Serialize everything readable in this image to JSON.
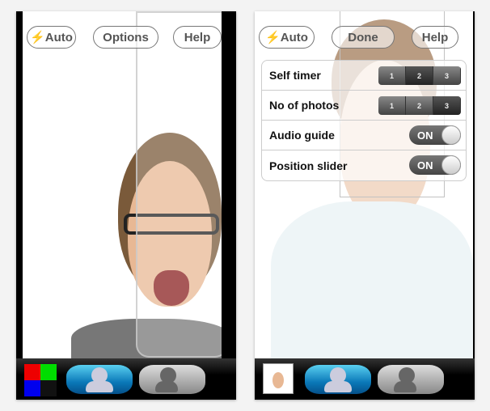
{
  "left": {
    "auto_label": "⚡Auto",
    "options_label": "Options",
    "help_label": "Help"
  },
  "right": {
    "auto_label": "⚡Auto",
    "done_label": "Done",
    "help_label": "Help",
    "settings": [
      {
        "label": "Self timer",
        "type": "segmented",
        "options": [
          "1",
          "2",
          "3"
        ],
        "selected": "2"
      },
      {
        "label": "No of photos",
        "type": "segmented",
        "options": [
          "1",
          "2",
          "3"
        ],
        "selected": "3"
      },
      {
        "label": "Audio guide",
        "type": "toggle",
        "value": "ON"
      },
      {
        "label": "Position slider",
        "type": "toggle",
        "value": "ON"
      }
    ]
  },
  "toolbar": {
    "single_mode": "single-person-icon",
    "group_mode": "group-people-icon"
  }
}
